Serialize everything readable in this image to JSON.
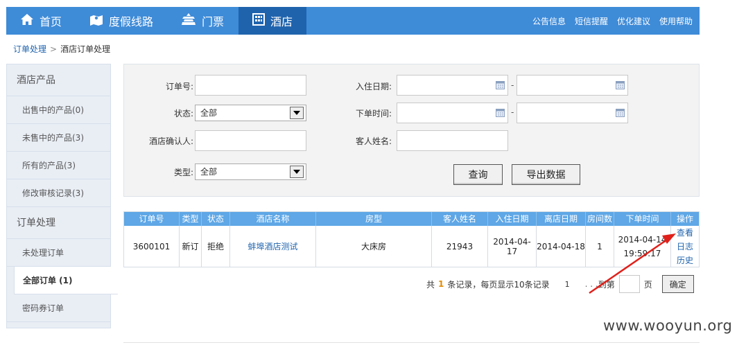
{
  "nav": {
    "items": [
      {
        "label": "首页",
        "icon": "home-icon"
      },
      {
        "label": "度假线路",
        "icon": "map-icon"
      },
      {
        "label": "门票",
        "icon": "temple-icon"
      },
      {
        "label": "酒店",
        "icon": "hotel-icon"
      }
    ],
    "active": "酒店",
    "links": [
      "公告信息",
      "短信提醒",
      "优化建议",
      "使用帮助"
    ],
    "colors": {
      "bar": "#3e8bd8",
      "active": "#1f63ad"
    }
  },
  "breadcrumb": {
    "parent": "订单处理",
    "sep": ">",
    "current": "酒店订单处理"
  },
  "sidebar": {
    "section1": "酒店产品",
    "products": [
      "出售中的产品(0)",
      "未售中的产品(3)",
      "所有的产品(3)",
      "修改审核记录(3)"
    ],
    "section2": "订单处理",
    "orders": [
      "未处理订单",
      "全部订单 (1)",
      "密码券订单"
    ]
  },
  "search": {
    "order_no_label": "订单号:",
    "status_label": "状态:",
    "status_value": "全部",
    "confirmer_label": "酒店确认人:",
    "type_label": "类型:",
    "type_value": "全部",
    "checkin_label": "入住日期:",
    "order_time_label": "下单时间:",
    "guest_label": "客人姓名:",
    "dash": "-",
    "query_button": "查询",
    "export_button": "导出数据"
  },
  "table": {
    "headers": [
      "订单号",
      "类型",
      "状态",
      "酒店名称",
      "房型",
      "客人姓名",
      "入住日期",
      "离店日期",
      "房间数",
      "下单时间",
      "操作"
    ],
    "rows": [
      {
        "order_no": "3600101",
        "type": "新订",
        "status": "拒绝",
        "hotel": "蚌埠酒店测试",
        "room": "大床房",
        "guest": "21943",
        "checkin": "2014-04-17",
        "checkout": "2014-04-18",
        "rooms": "1",
        "order_time_date": "2014-04-14",
        "order_time_time": "19:59:17",
        "ops": [
          "查看",
          "日志",
          "历史"
        ]
      }
    ]
  },
  "pager": {
    "prefix": "共",
    "count": "1",
    "suffix": "条记录，每页显示10条记录",
    "page": "1",
    "dots": ". . .",
    "goto_label": "到第",
    "page_unit": "页",
    "confirm": "确定"
  },
  "watermark": "www.wooyun.org"
}
